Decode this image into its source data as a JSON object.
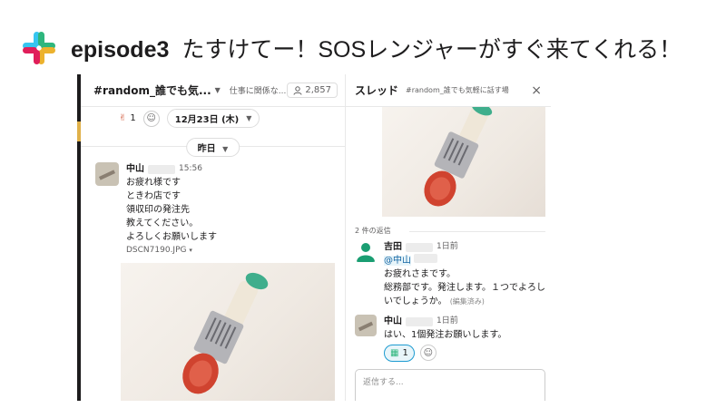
{
  "slide": {
    "episode": "episode3",
    "title": "たすけてー！SOSレンジャーがすぐ来てくれる！"
  },
  "colors": {
    "slack_green": "#2eb67d",
    "slack_blue": "#36c5f0",
    "slack_yellow": "#ecb22e",
    "slack_red": "#e01e5a",
    "mention_blue": "#1264a3"
  },
  "channel": {
    "name": "#random_誰でも気...",
    "topic": "仕事に関係な...",
    "member_count": "2,857",
    "reaction_count": "1",
    "date_pill": "12月23日 (木)",
    "day_divider": "昨日",
    "message": {
      "author": "中山",
      "time": "15:56",
      "lines": [
        "お疲れ様です",
        "ときわ店です",
        "領収印の発注先",
        "教えてください。",
        "よろしくお願いします"
      ],
      "file_name": "DSCN7190.JPG"
    }
  },
  "thread": {
    "title": "スレッド",
    "channel": "#random_誰でも気軽に話す場",
    "close_icon": "×",
    "reply_count": "2 件の返信",
    "replies": [
      {
        "author": "吉田",
        "time": "1日前",
        "mention": "@中山",
        "lines": [
          "お疲れさまです。",
          "総務部です。発注します。１つでよろし",
          "いでしょうか。"
        ],
        "edited": "(編集済み)"
      },
      {
        "author": "中山",
        "time": "1日前",
        "lines": [
          "はい、1個発注お願いします。"
        ],
        "reaction_count": "1"
      }
    ],
    "composer_placeholder": "返信する..."
  }
}
